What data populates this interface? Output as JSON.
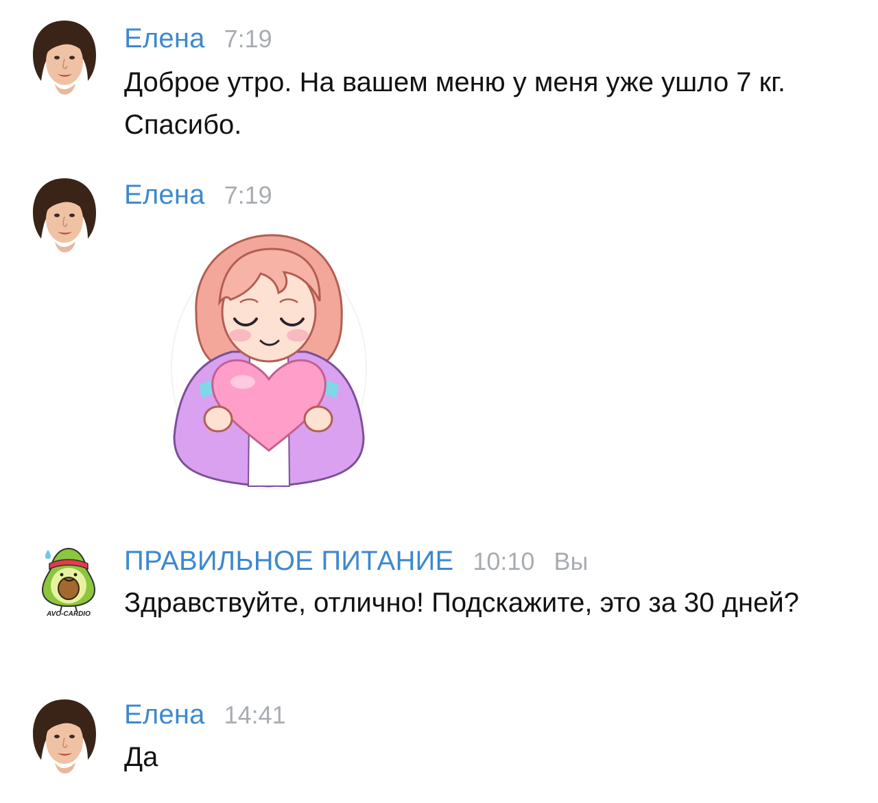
{
  "messages": [
    {
      "author": "Елена",
      "time": "7:19",
      "text": "Доброе утро. На вашем меню у меня уже ушло 7 кг. Спасибо."
    },
    {
      "author": "Елена",
      "time": "7:19",
      "sticker": "girl-hugging-heart-sticker"
    },
    {
      "author": "ПРАВИЛЬНОЕ ПИТАНИЕ",
      "time": "10:10",
      "you_label": "Вы",
      "avatar_caption": "AVO-CARDIO",
      "text": "Здравствуйте, отлично! Подскажите, это за 30 дней?"
    },
    {
      "author": "Елена",
      "time": "14:41",
      "text": "Да"
    }
  ],
  "colors": {
    "name": "#3c88cf",
    "time": "#a8acb2",
    "text": "#111111",
    "background": "#ffffff"
  }
}
